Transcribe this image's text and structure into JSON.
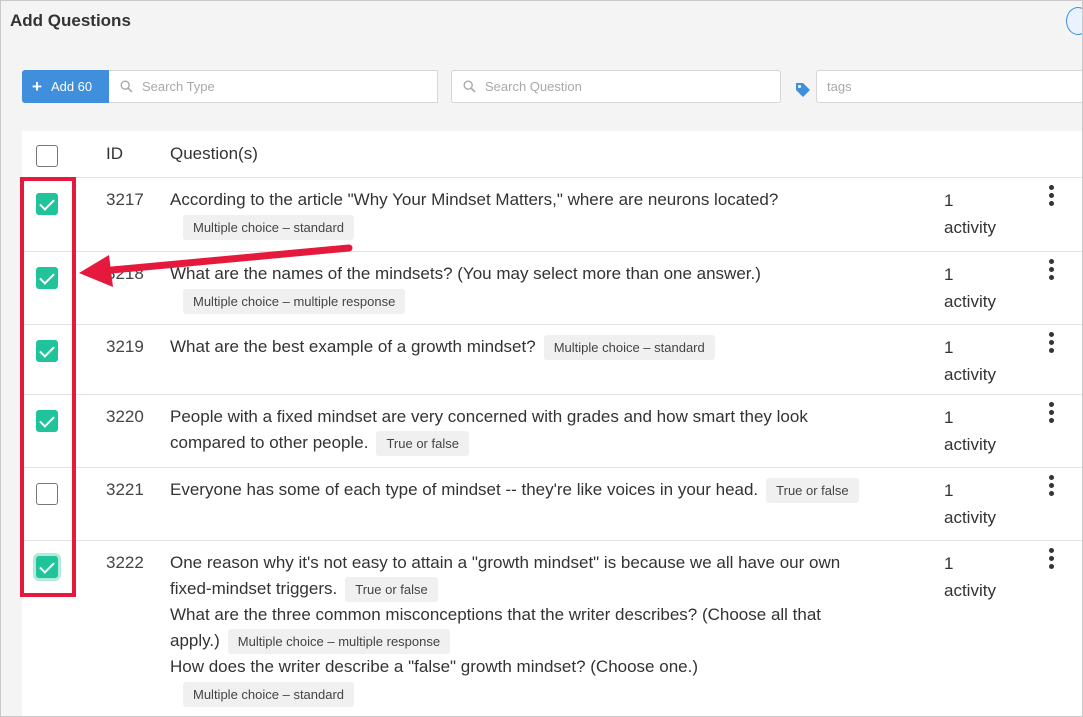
{
  "title": "Add Questions",
  "toolbar": {
    "add_label": "Add 60",
    "search_type_placeholder": "Search Type",
    "search_question_placeholder": "Search Question",
    "tags_placeholder": "tags"
  },
  "table": {
    "col_id": "ID",
    "col_questions": "Question(s)",
    "rows": [
      {
        "id": "3217",
        "checked": true,
        "lines": [
          {
            "text": "According to the article \"Why Your Mindset Matters,\" where are neurons located?"
          }
        ],
        "badge": "Multiple choice – standard",
        "activity_count": "1",
        "activity_label": "activity"
      },
      {
        "id": "3218",
        "checked": true,
        "lines": [
          {
            "text": "What are the names of the mindsets?  (You may select more than one answer.)"
          }
        ],
        "badge": "Multiple choice – multiple response",
        "activity_count": "1",
        "activity_label": "activity"
      },
      {
        "id": "3219",
        "checked": true,
        "lines": [
          {
            "text": "What are the best example of a growth mindset?"
          }
        ],
        "badge": "Multiple choice – standard",
        "activity_count": "1",
        "activity_label": "activity"
      },
      {
        "id": "3220",
        "checked": true,
        "lines": [
          {
            "text": "People with a fixed mindset are very concerned with grades and how smart they look"
          },
          {
            "text": "compared to other people."
          }
        ],
        "badge": "True or false",
        "activity_count": "1",
        "activity_label": "activity"
      },
      {
        "id": "3221",
        "checked": false,
        "lines": [
          {
            "text": "Everyone has some of each type of mindset -- they're like voices in your head."
          }
        ],
        "badge": "True or false",
        "activity_count": "1",
        "activity_label": "activity"
      },
      {
        "id": "3222",
        "checked": true,
        "lines": [
          {
            "text": "One reason why it's not easy to attain a \"growth mindset\" is because we all have our own"
          },
          {
            "text": "fixed-mindset triggers."
          },
          {
            "text": "What are the three common misconceptions that the writer describes?  (Choose all that"
          },
          {
            "text": "apply.)"
          },
          {
            "text": "How does the writer describe a \"false\" growth mindset?  (Choose one.)"
          }
        ],
        "badges": [
          "True or false",
          "Multiple choice – multiple response",
          "Multiple choice – standard"
        ],
        "activity_count": "1",
        "activity_label": "activity"
      }
    ]
  },
  "colors": {
    "accent": "#3f8fdc",
    "checked": "#21c49a",
    "annotation": "#e5193c"
  }
}
